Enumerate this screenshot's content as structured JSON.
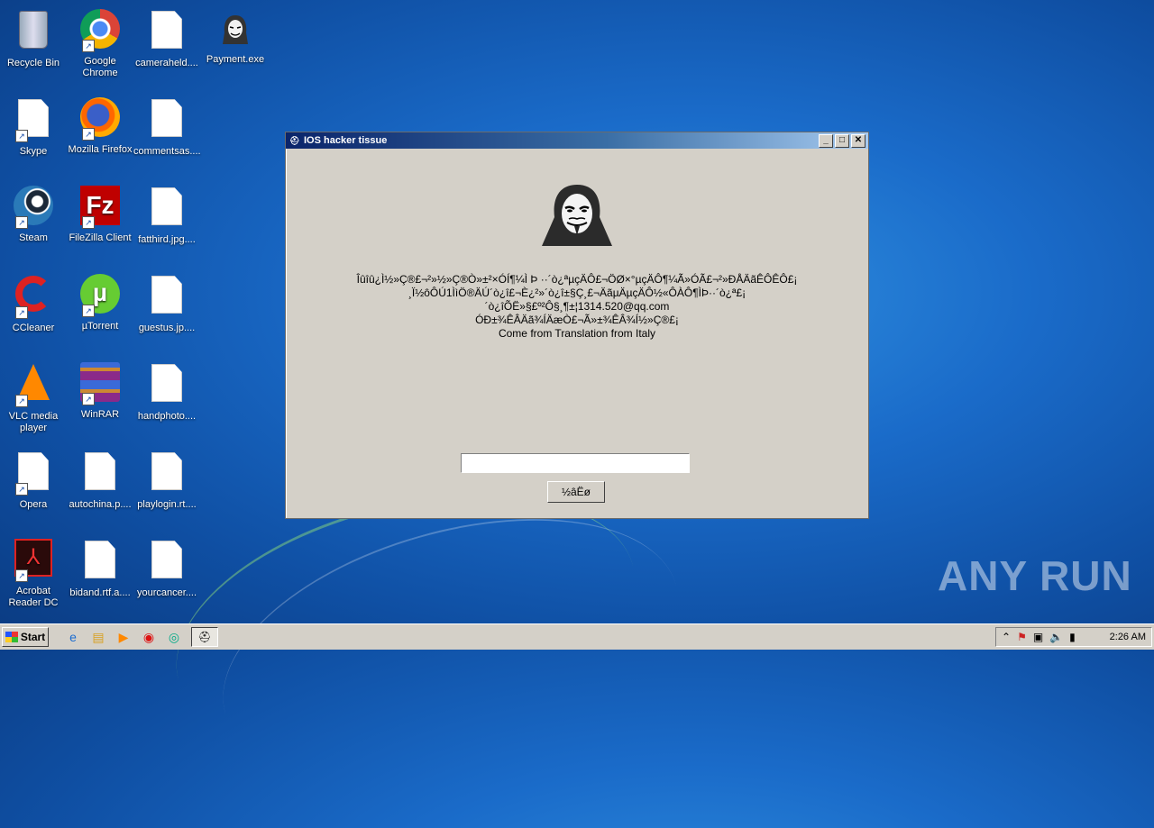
{
  "desktop": {
    "icons": [
      {
        "label": "Recycle Bin",
        "icon": "recycle-bin-icon"
      },
      {
        "label": "Google Chrome",
        "icon": "chrome-icon"
      },
      {
        "label": "cameraheld....",
        "icon": "document-icon"
      },
      {
        "label": "Payment.exe",
        "icon": "anonymous-mask-icon"
      },
      {
        "label": "Skype",
        "icon": "document-icon"
      },
      {
        "label": "Mozilla Firefox",
        "icon": "firefox-icon"
      },
      {
        "label": "commentsas....",
        "icon": "document-icon"
      },
      {
        "label": "Steam",
        "icon": "steam-icon"
      },
      {
        "label": "FileZilla Client",
        "icon": "filezilla-icon"
      },
      {
        "label": "fatthird.jpg....",
        "icon": "document-icon"
      },
      {
        "label": "CCleaner",
        "icon": "ccleaner-icon"
      },
      {
        "label": "µTorrent",
        "icon": "utorrent-icon"
      },
      {
        "label": "guestus.jp....",
        "icon": "document-icon"
      },
      {
        "label": "VLC media player",
        "icon": "vlc-icon"
      },
      {
        "label": "WinRAR",
        "icon": "winrar-icon"
      },
      {
        "label": "handphoto....",
        "icon": "document-icon"
      },
      {
        "label": "Opera",
        "icon": "document-icon"
      },
      {
        "label": "autochina.p....",
        "icon": "document-icon"
      },
      {
        "label": "playlogin.rt....",
        "icon": "document-icon"
      },
      {
        "label": "Acrobat Reader DC",
        "icon": "acrobat-icon"
      },
      {
        "label": "bidand.rtf.a....",
        "icon": "document-icon"
      },
      {
        "label": "yourcancer....",
        "icon": "document-icon"
      }
    ]
  },
  "window": {
    "title": "IOS hacker tissue",
    "minimize": "_",
    "maximize": "□",
    "close": "✕",
    "message_lines": [
      "Îûîû¿Ì½»Ç®£¬²»½»Ç®Ò»±²×ÓÍ¶¼Ì Þ ··´ò¿ªµçÄÔ£¬ÖØ×°µçÄÔ¶¼Ã»ÓÃ£¬²»ÐÅÄãÊÔÊÔ£¡",
      "¸Ï½ôÔÚ1ÌìÖ®ÄÚ´ò¿î£¬È¿²»´ò¿î±§Ç¸£¬ÄãµÄµçÄÔ½«ÔÀÔ¶ÌÞ··´ò¿ª£¡",
      "´ò¿îÕË»§£º²Ô§¸¶±¦1314.520@qq.com",
      "ÓÐ±¾ÊÂÄã¾ÍÄæÒ­£¬Ã»±¾ÊÂ¾Í½»Ç®£¡",
      "Come from Translation from Italy"
    ],
    "input_value": "",
    "button_label": "½âËø"
  },
  "watermark": "ANY RUN",
  "taskbar": {
    "start_label": "Start",
    "quick_launch": [
      "ie-icon",
      "explorer-icon",
      "media-player-icon",
      "opera-icon",
      "chrome-icon"
    ],
    "active_task_icon": "anonymous-mask-icon",
    "clock": "2:26 AM"
  }
}
